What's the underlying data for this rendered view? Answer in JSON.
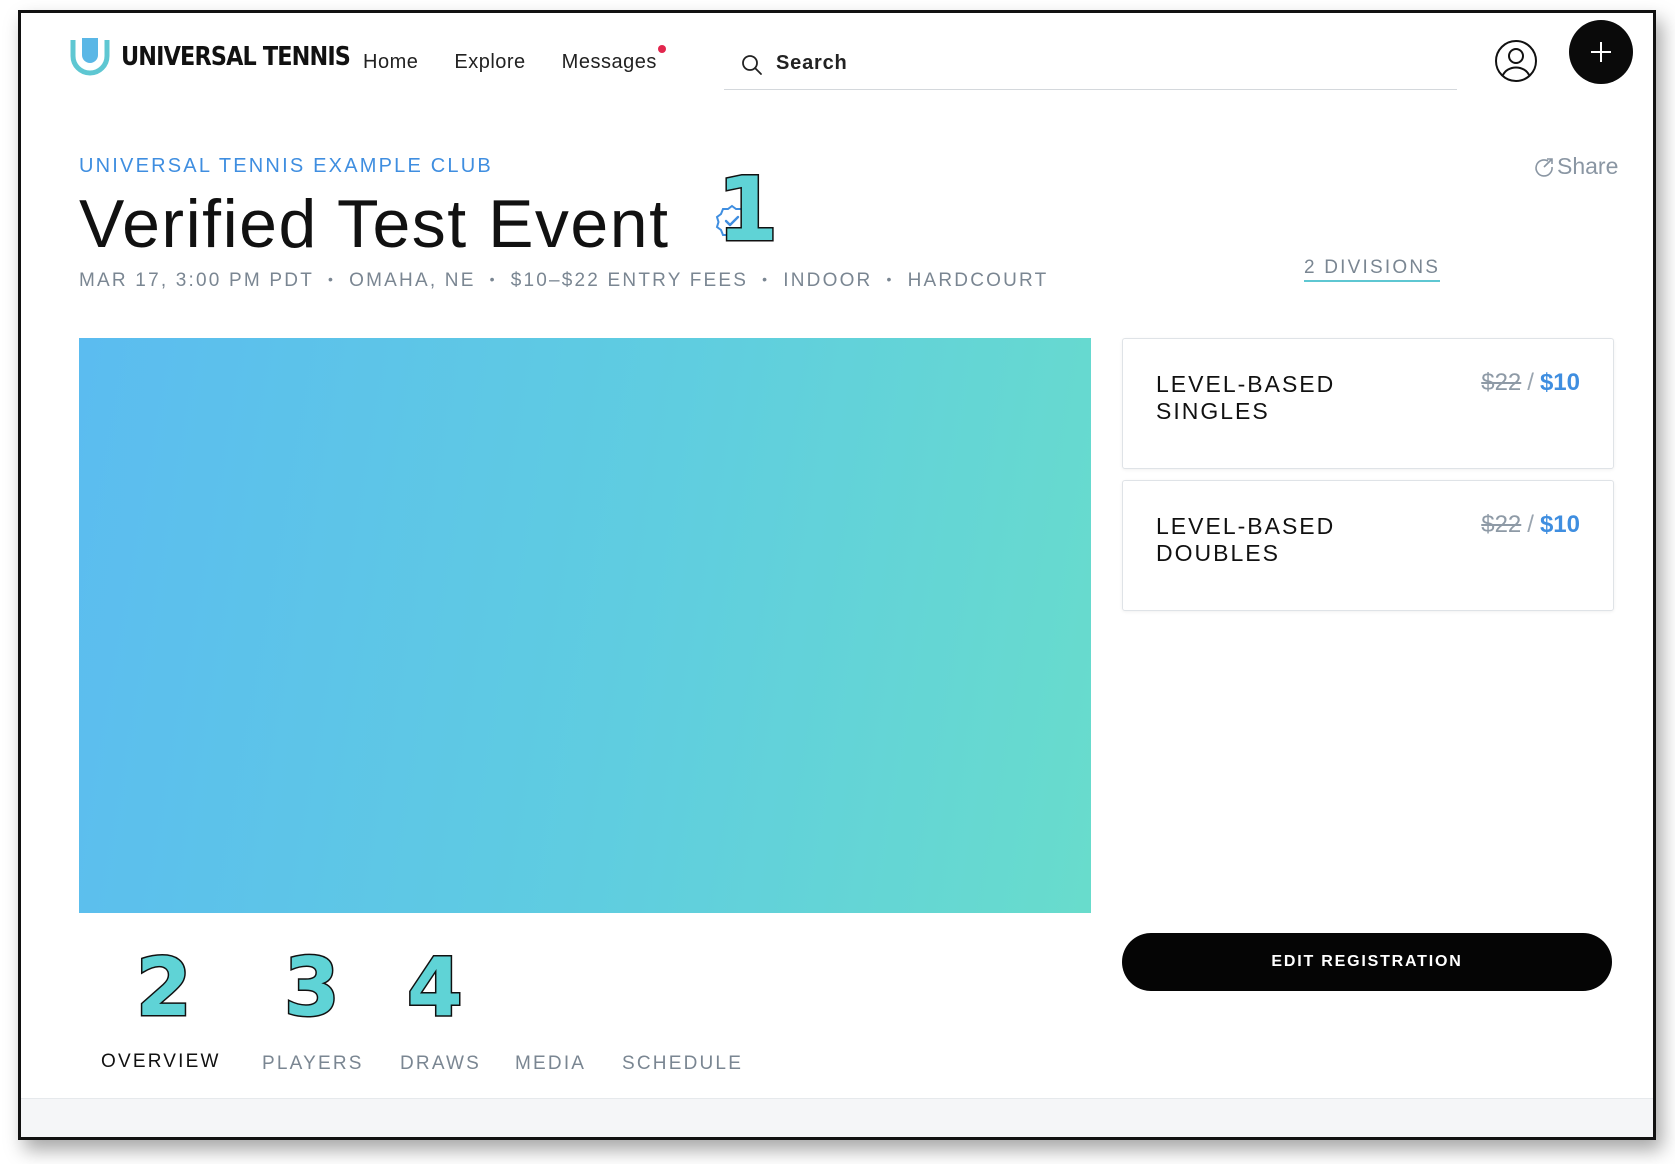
{
  "brand": {
    "name": "UNIVERSAL TENNIS"
  },
  "nav": {
    "items": [
      "Home",
      "Explore",
      "Messages"
    ]
  },
  "search": {
    "placeholder": "Search"
  },
  "event": {
    "club": "UNIVERSAL TENNIS EXAMPLE CLUB",
    "title": "Verified Test Event",
    "share_label": "Share",
    "meta": [
      "MAR 17, 3:00 PM PDT",
      "OMAHA, NE",
      "$10–$22 ENTRY FEES",
      "INDOOR",
      "HARDCOURT"
    ],
    "divisions_link": "2 DIVISIONS"
  },
  "divisions": [
    {
      "name": "LEVEL-BASED SINGLES",
      "old_price": "$22",
      "separator": "/",
      "price": "$10"
    },
    {
      "name": "LEVEL-BASED DOUBLES",
      "old_price": "$22",
      "separator": "/",
      "price": "$10"
    }
  ],
  "actions": {
    "edit_registration": "EDIT REGISTRATION"
  },
  "tabs": [
    {
      "label": "OVERVIEW",
      "active": true
    },
    {
      "label": "PLAYERS",
      "active": false
    },
    {
      "label": "DRAWS",
      "active": false
    },
    {
      "label": "MEDIA",
      "active": false
    },
    {
      "label": "SCHEDULE",
      "active": false
    }
  ],
  "annotations": [
    "1",
    "2",
    "3",
    "4"
  ],
  "colors": {
    "accent_blue": "#3f8ee0",
    "teal": "#5ec7d2",
    "annotation": "#5fd3d6",
    "dark": "#050505"
  },
  "icons": [
    "universal-tennis-logo",
    "search-icon",
    "user-avatar-icon",
    "plus-icon",
    "share-icon",
    "verified-badge-icon"
  ]
}
